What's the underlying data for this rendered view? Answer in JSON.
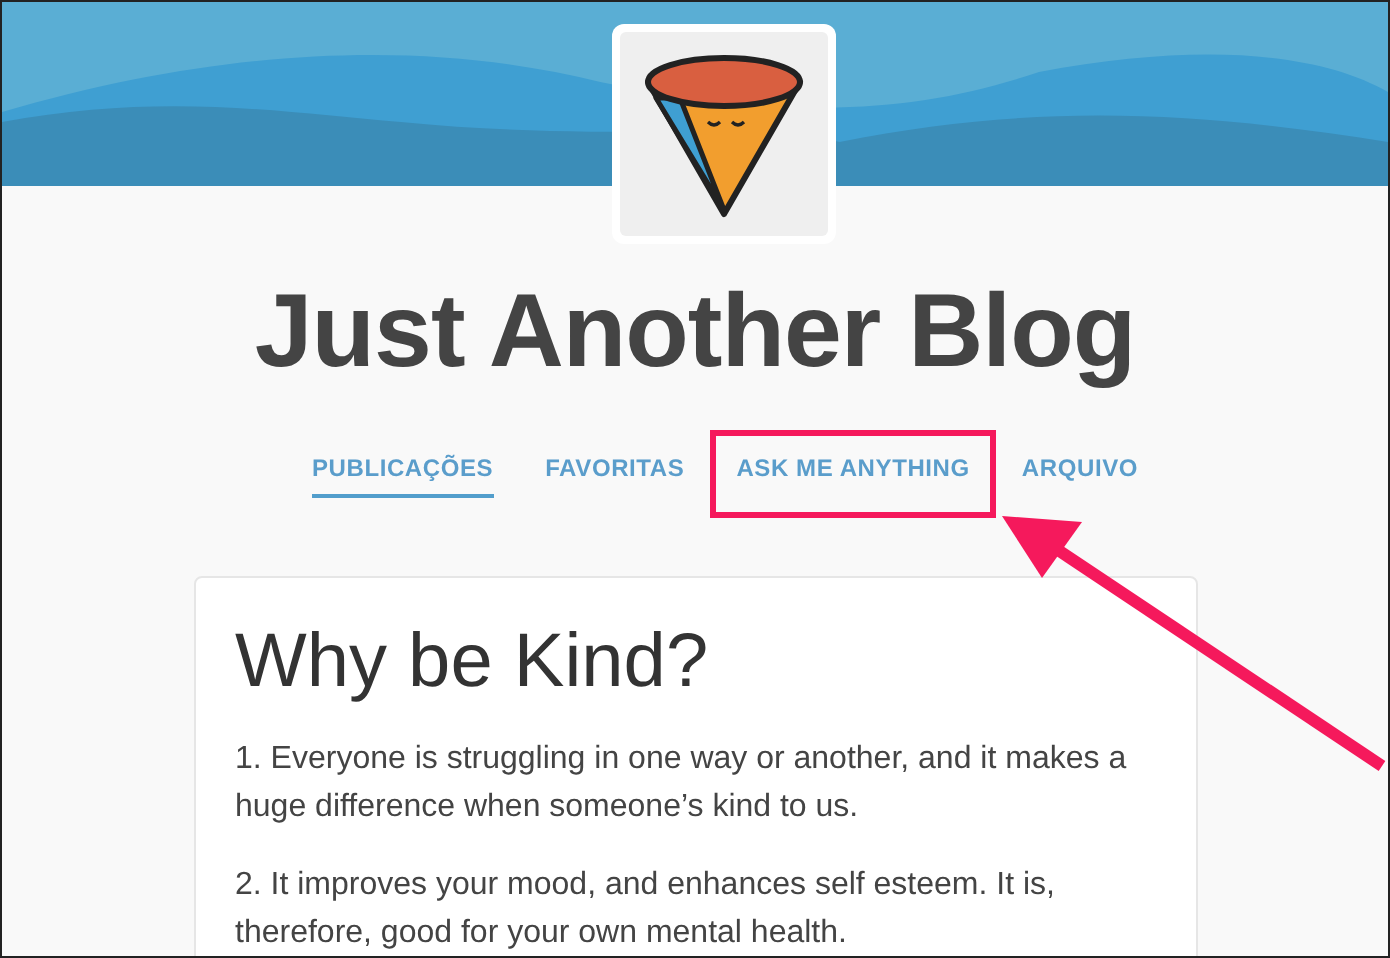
{
  "blog": {
    "title": "Just Another Blog"
  },
  "nav": [
    {
      "label": "PUBLICAÇÕES",
      "selected": true,
      "highlighted": false
    },
    {
      "label": "FAVORITAS",
      "selected": false,
      "highlighted": false
    },
    {
      "label": "ASK ME ANYTHING",
      "selected": false,
      "highlighted": true
    },
    {
      "label": "ARQUIVO",
      "selected": false,
      "highlighted": false
    }
  ],
  "annotation_arrow": true,
  "post": {
    "title": "Why be Kind?",
    "paragraphs": [
      "1. Everyone is struggling in one way or another, and it makes a huge difference when someone’s kind to us.",
      "2. It improves your mood, and enhances self esteem. It is, therefore, good for your own mental health."
    ]
  }
}
